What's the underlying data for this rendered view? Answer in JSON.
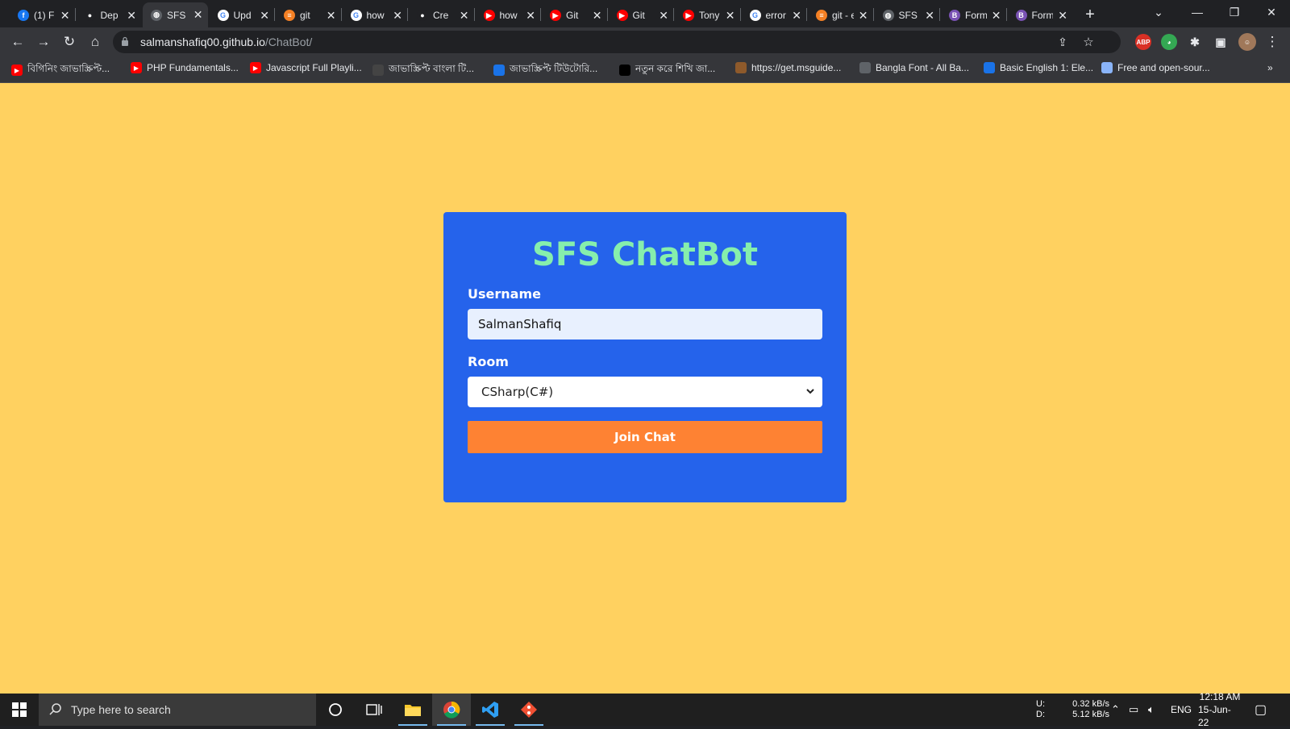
{
  "browser": {
    "tabs": [
      {
        "title": "(1) F",
        "icon": "facebook-icon",
        "color": "#1877f2",
        "glyph": "f"
      },
      {
        "title": "Dep",
        "icon": "github-icon",
        "color": "#202124",
        "glyph": "●"
      },
      {
        "title": "SFS",
        "icon": "globe-icon",
        "color": "#5f6368",
        "glyph": "◍",
        "active": true
      },
      {
        "title": "Upd",
        "icon": "google-icon",
        "color": "#ffffff",
        "glyph": "G"
      },
      {
        "title": "git",
        "icon": "stackoverflow-icon",
        "color": "#f48024",
        "glyph": "≡"
      },
      {
        "title": "how",
        "icon": "google-icon",
        "color": "#ffffff",
        "glyph": "G"
      },
      {
        "title": "Cre",
        "icon": "github-icon",
        "color": "#202124",
        "glyph": "●"
      },
      {
        "title": "how",
        "icon": "youtube-icon",
        "color": "#ff0000",
        "glyph": "▶"
      },
      {
        "title": "Git",
        "icon": "youtube-icon",
        "color": "#ff0000",
        "glyph": "▶"
      },
      {
        "title": "Git",
        "icon": "youtube-icon",
        "color": "#ff0000",
        "glyph": "▶"
      },
      {
        "title": "Tony St",
        "icon": "youtube-icon",
        "color": "#ff0000",
        "glyph": "▶"
      },
      {
        "title": "error: fa",
        "icon": "google-icon",
        "color": "#ffffff",
        "glyph": "G"
      },
      {
        "title": "git - err",
        "icon": "stackoverflow-icon",
        "color": "#f48024",
        "glyph": "≡"
      },
      {
        "title": "SFS Cha",
        "icon": "globe-icon",
        "color": "#5f6368",
        "glyph": "◍"
      },
      {
        "title": "Forms",
        "icon": "bootstrap-icon",
        "color": "#7952b3",
        "glyph": "B"
      },
      {
        "title": "Forms",
        "icon": "bootstrap-icon",
        "color": "#7952b3",
        "glyph": "B"
      }
    ],
    "url_host": "salmanshafiq00.github.io",
    "url_path": "/ChatBot/",
    "bookmarks": [
      {
        "label": "বিগিনিং জাভাস্ক্রিপ্ট...",
        "icon": "youtube-icon",
        "color": "#ff0000"
      },
      {
        "label": "PHP Fundamentals...",
        "icon": "youtube-icon",
        "color": "#ff0000"
      },
      {
        "label": "Javascript Full Playli...",
        "icon": "youtube-icon",
        "color": "#ff0000"
      },
      {
        "label": "জাভাস্ক্রিপ্ট বাংলা টি...",
        "icon": "site-icon",
        "color": "#444444"
      },
      {
        "label": "জাভাস্ক্রিপ্ট টিউটোরি...",
        "icon": "circle-site-icon",
        "color": "#1a73e8"
      },
      {
        "label": "নতুন করে শিখি জা...",
        "icon": "cap-icon",
        "color": "#000000"
      },
      {
        "label": "https://get.msguide...",
        "icon": "grid-icon",
        "color": "#8e5a2b"
      },
      {
        "label": "Bangla Font - All Ba...",
        "icon": "globe-icon",
        "color": "#5f6368"
      },
      {
        "label": "Basic English 1: Ele...",
        "icon": "infinity-icon",
        "color": "#1a73e8"
      },
      {
        "label": "Free and open-sour...",
        "icon": "dots-icon",
        "color": "#8ab4f8"
      }
    ]
  },
  "page": {
    "title": "SFS ChatBot",
    "username_label": "Username",
    "username_value": "SalmanShafiq",
    "room_label": "Room",
    "room_selected": "CSharp(C#)",
    "join_button": "Join Chat",
    "colors": {
      "background": "#ffd160",
      "card": "#2563eb",
      "title": "#86efac",
      "button": "#fe8233"
    }
  },
  "taskbar": {
    "search_placeholder": "Type here to search",
    "net_upload_label": "U:",
    "net_download_label": "D:",
    "net_upload": "0.32 kB/s",
    "net_download": "5.12 kB/s",
    "language": "ENG",
    "time": "12:18 AM",
    "date": "15-Jun-22"
  }
}
